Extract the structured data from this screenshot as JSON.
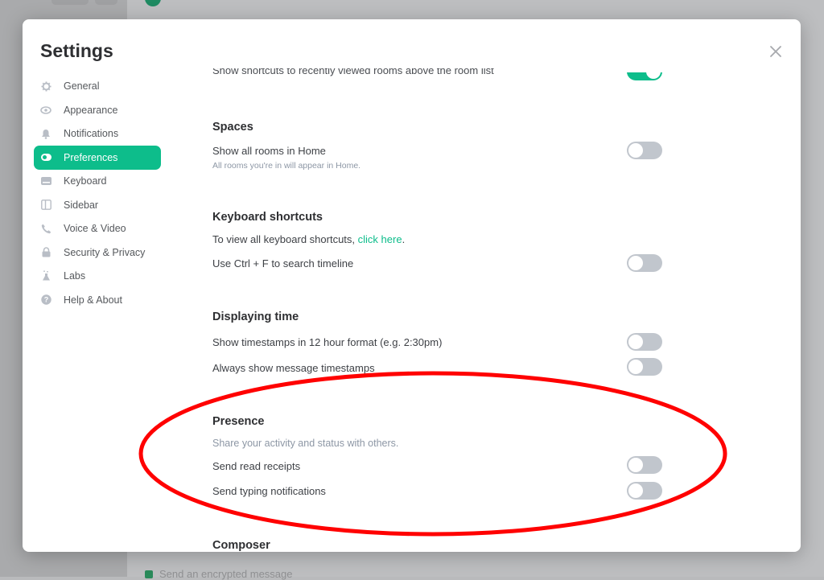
{
  "background": {
    "composer_hint": "Send an encrypted message"
  },
  "dialog": {
    "title": "Settings",
    "close_icon": "close-icon"
  },
  "sidebar": {
    "items": [
      {
        "label": "General",
        "icon": "gear-icon",
        "active": false
      },
      {
        "label": "Appearance",
        "icon": "eye-icon",
        "active": false
      },
      {
        "label": "Notifications",
        "icon": "bell-icon",
        "active": false
      },
      {
        "label": "Preferences",
        "icon": "toggle-icon",
        "active": true
      },
      {
        "label": "Keyboard",
        "icon": "keyboard-icon",
        "active": false
      },
      {
        "label": "Sidebar",
        "icon": "sidebar-icon",
        "active": false
      },
      {
        "label": "Voice & Video",
        "icon": "phone-icon",
        "active": false
      },
      {
        "label": "Security & Privacy",
        "icon": "lock-icon",
        "active": false
      },
      {
        "label": "Labs",
        "icon": "flask-icon",
        "active": false
      },
      {
        "label": "Help & About",
        "icon": "help-icon",
        "active": false
      }
    ]
  },
  "content": {
    "top_partial": {
      "label": "Show shortcuts to recently viewed rooms above the room list",
      "enabled": true
    },
    "spaces": {
      "heading": "Spaces",
      "show_all_rooms": {
        "label": "Show all rooms in Home",
        "description": "All rooms you're in will appear in Home.",
        "enabled": false
      }
    },
    "keyboard_shortcuts": {
      "heading": "Keyboard shortcuts",
      "info_prefix": "To view all keyboard shortcuts, ",
      "info_link": "click here",
      "info_suffix": ".",
      "ctrl_f": {
        "label": "Use Ctrl + F to search timeline",
        "enabled": false
      }
    },
    "displaying_time": {
      "heading": "Displaying time",
      "twelve_hour": {
        "label": "Show timestamps in 12 hour format (e.g. 2:30pm)",
        "enabled": false
      },
      "always_show": {
        "label": "Always show message timestamps",
        "enabled": false
      }
    },
    "presence": {
      "heading": "Presence",
      "description": "Share your activity and status with others.",
      "read_receipts": {
        "label": "Send read receipts",
        "enabled": false
      },
      "typing_notifications": {
        "label": "Send typing notifications",
        "enabled": false
      }
    },
    "composer": {
      "heading": "Composer"
    }
  },
  "annotation": {
    "shape": "ellipse",
    "color": "#ff0000",
    "target": "Presence section"
  }
}
